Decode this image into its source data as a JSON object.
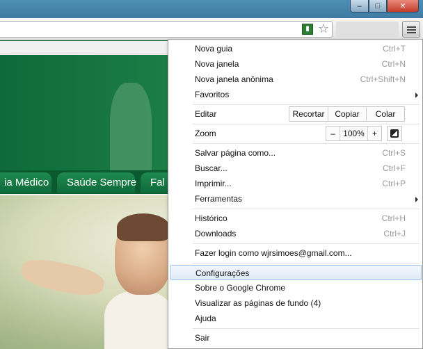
{
  "window": {
    "minimize_glyph": "–",
    "maximize_glyph": "□",
    "close_glyph": "✕"
  },
  "toolbar": {
    "star_glyph": "☆",
    "extension_glyph": "▮"
  },
  "page": {
    "nav_tabs": [
      "ia Médico",
      "Saúde Sempre",
      "Fal"
    ]
  },
  "menu": {
    "new_tab": {
      "label": "Nova guia",
      "shortcut": "Ctrl+T"
    },
    "new_window": {
      "label": "Nova janela",
      "shortcut": "Ctrl+N"
    },
    "incognito": {
      "label": "Nova janela anônima",
      "shortcut": "Ctrl+Shift+N"
    },
    "bookmarks": {
      "label": "Favoritos"
    },
    "edit": {
      "label": "Editar",
      "cut": "Recortar",
      "copy": "Copiar",
      "paste": "Colar"
    },
    "zoom": {
      "label": "Zoom",
      "minus": "–",
      "value": "100%",
      "plus": "+"
    },
    "save_page": {
      "label": "Salvar página como...",
      "shortcut": "Ctrl+S"
    },
    "find": {
      "label": "Buscar...",
      "shortcut": "Ctrl+F"
    },
    "print": {
      "label": "Imprimir...",
      "shortcut": "Ctrl+P"
    },
    "tools": {
      "label": "Ferramentas"
    },
    "history": {
      "label": "Histórico",
      "shortcut": "Ctrl+H"
    },
    "downloads": {
      "label": "Downloads",
      "shortcut": "Ctrl+J"
    },
    "sign_in": {
      "label": "Fazer login como wjrsimoes@gmail.com..."
    },
    "settings": {
      "label": "Configurações"
    },
    "about": {
      "label": "Sobre o Google Chrome"
    },
    "background_pages": {
      "label": "Visualizar as páginas de fundo (4)"
    },
    "help": {
      "label": "Ajuda"
    },
    "exit": {
      "label": "Sair"
    }
  }
}
